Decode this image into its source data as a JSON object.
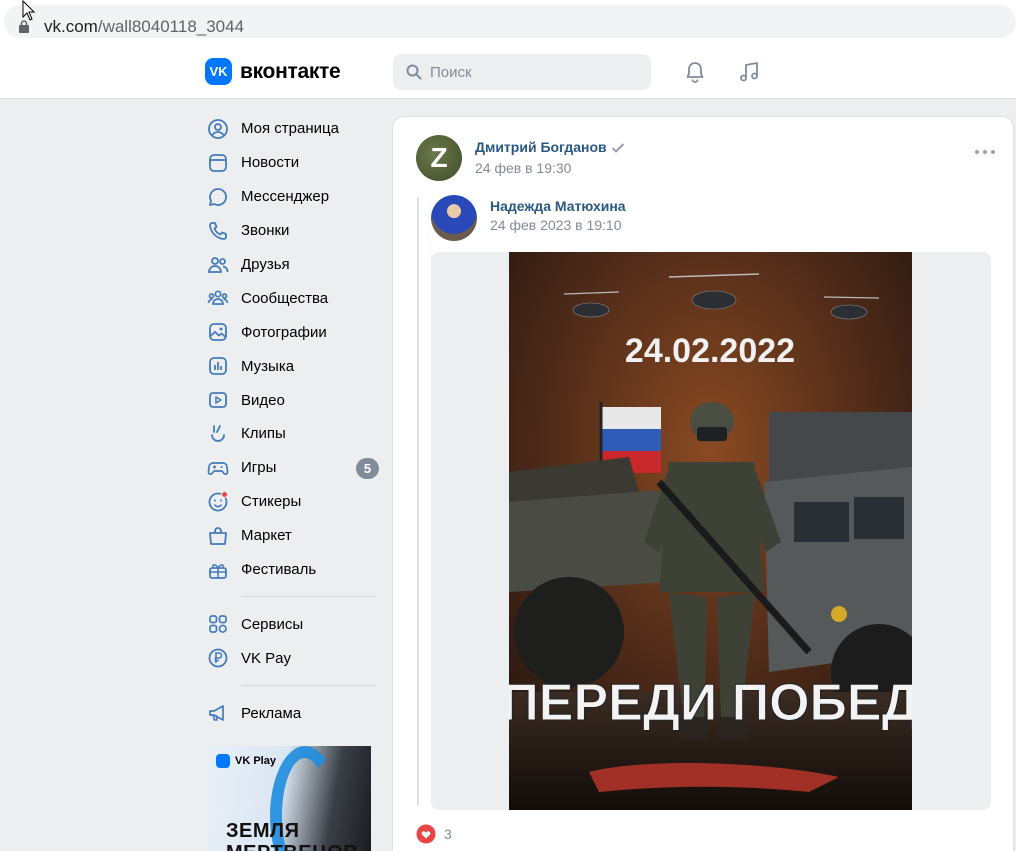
{
  "browser": {
    "url_host": "vk.com",
    "url_path": "/wall8040118_3044"
  },
  "header": {
    "logo_text": "вконтакте",
    "logo_mark": "VK",
    "search_placeholder": "Поиск"
  },
  "sidebar": {
    "items": [
      {
        "label": "Моя страница",
        "icon": "user-circle-icon"
      },
      {
        "label": "Новости",
        "icon": "news-icon"
      },
      {
        "label": "Мессенджер",
        "icon": "message-icon"
      },
      {
        "label": "Звонки",
        "icon": "phone-icon"
      },
      {
        "label": "Друзья",
        "icon": "friends-icon"
      },
      {
        "label": "Сообщества",
        "icon": "communities-icon"
      },
      {
        "label": "Фотографии",
        "icon": "photos-icon"
      },
      {
        "label": "Музыка",
        "icon": "music-icon"
      },
      {
        "label": "Видео",
        "icon": "video-icon"
      },
      {
        "label": "Клипы",
        "icon": "clips-icon"
      },
      {
        "label": "Игры",
        "icon": "games-icon",
        "badge": "5"
      },
      {
        "label": "Стикеры",
        "icon": "stickers-icon"
      },
      {
        "label": "Маркет",
        "icon": "market-icon"
      },
      {
        "label": "Фестиваль",
        "icon": "festival-icon"
      }
    ],
    "services": [
      {
        "label": "Сервисы",
        "icon": "services-icon"
      },
      {
        "label": "VK Pay",
        "icon": "vkpay-icon"
      }
    ],
    "ads_label": "Реклама",
    "ad_banner": {
      "brand": "VK Play",
      "title": "ЗЕМЛЯ МЕРТВЕЦОВ"
    }
  },
  "post": {
    "author": "Дмитрий Богданов",
    "author_avatar_letter": "Z",
    "date": "24 фев в 19:30",
    "repost": {
      "author": "Надежда Матюхина",
      "date": "24 фев 2023 в 19:10"
    },
    "image": {
      "date_text": "24.02.2022",
      "slogan": "ВПЕРЕДИ ПОБЕДА"
    },
    "likes": "3"
  },
  "colors": {
    "accent": "#0077ff",
    "link": "#2a5885",
    "muted": "#818c99",
    "like": "#e64646"
  }
}
